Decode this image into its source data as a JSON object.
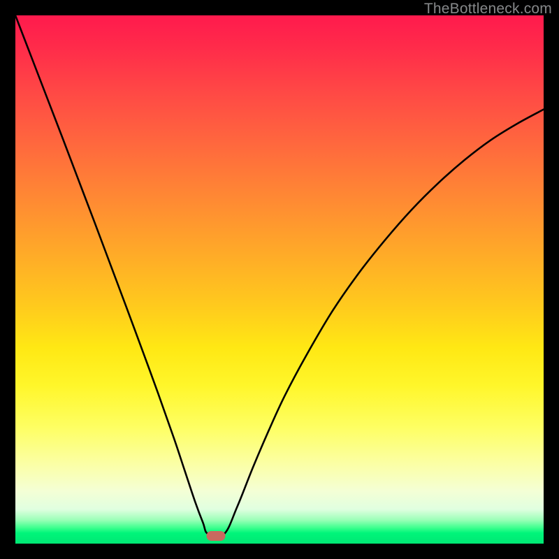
{
  "watermark": "TheBottleneck.com",
  "marker": {
    "x_frac": 0.379,
    "y_frac": 0.985
  },
  "chart_data": {
    "type": "line",
    "title": "",
    "xlabel": "",
    "ylabel": "",
    "xlim": [
      0,
      1
    ],
    "ylim": [
      0,
      1
    ],
    "annotations": [
      "TheBottleneck.com"
    ],
    "series": [
      {
        "name": "left-branch",
        "x": [
          0.0,
          0.03,
          0.06,
          0.09,
          0.12,
          0.15,
          0.18,
          0.21,
          0.24,
          0.27,
          0.3,
          0.32,
          0.34,
          0.355,
          0.365
        ],
        "y": [
          1.0,
          0.922,
          0.844,
          0.766,
          0.687,
          0.608,
          0.528,
          0.448,
          0.367,
          0.285,
          0.2,
          0.14,
          0.08,
          0.04,
          0.018
        ]
      },
      {
        "name": "flat-valley",
        "x": [
          0.365,
          0.395
        ],
        "y": [
          0.018,
          0.018
        ]
      },
      {
        "name": "right-branch",
        "x": [
          0.395,
          0.42,
          0.45,
          0.48,
          0.51,
          0.55,
          0.6,
          0.65,
          0.7,
          0.75,
          0.8,
          0.85,
          0.9,
          0.95,
          1.0
        ],
        "y": [
          0.018,
          0.07,
          0.145,
          0.215,
          0.28,
          0.355,
          0.44,
          0.512,
          0.575,
          0.632,
          0.682,
          0.726,
          0.764,
          0.795,
          0.822
        ]
      }
    ],
    "gradient_scale": {
      "orientation": "vertical",
      "top_color": "#ff1a4d",
      "bottom_color": "#00e774",
      "description": "red (top) through orange/yellow to green (bottom)"
    },
    "marker": {
      "x": 0.379,
      "y": 0.015,
      "color": "#c9695f",
      "shape": "rounded-rect"
    }
  }
}
